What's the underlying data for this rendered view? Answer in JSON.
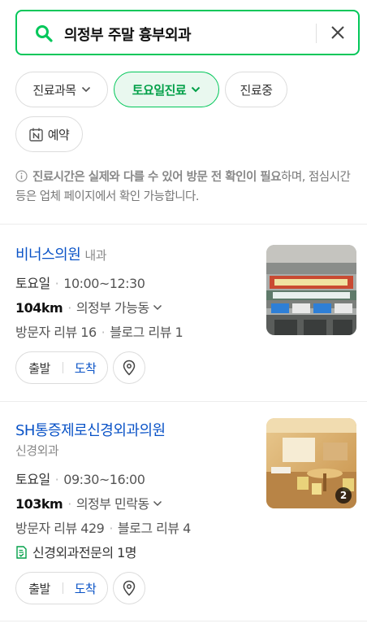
{
  "search": {
    "query": "의정부 주말 흉부외과"
  },
  "filters": [
    {
      "label": "진료과목",
      "active": false
    },
    {
      "label": "토요일진료",
      "active": true
    },
    {
      "label": "진료중",
      "active": false
    },
    {
      "label": "예약",
      "active": false
    }
  ],
  "notice": {
    "bold_text": "진료시간은 실제와 다를 수 있어 방문 전 확인이 필요",
    "rest_text": "하며, 점심시간 등은 업체 페이지에서 확인 가능합니다."
  },
  "results": [
    {
      "name": "비너스의원",
      "category": "내과",
      "day": "토요일",
      "hours": "10:00~12:30",
      "distance": "104km",
      "area": "의정부 가능동",
      "visitor_reviews": "방문자 리뷰 16",
      "blog_reviews": "블로그 리뷰 1",
      "depart_label": "출발",
      "arrive_label": "도착"
    },
    {
      "name": "SH통증제로신경외과의원",
      "category": "신경외과",
      "day": "토요일",
      "hours": "09:30~16:00",
      "distance": "103km",
      "area": "의정부 민락동",
      "visitor_reviews": "방문자 리뷰 429",
      "blog_reviews": "블로그 리뷰 4",
      "specialist": "신경외과전문의 1명",
      "photo_count": "2",
      "depart_label": "출발",
      "arrive_label": "도착"
    }
  ],
  "colors": {
    "accent": "#03c75a",
    "link": "#0a53c7"
  }
}
